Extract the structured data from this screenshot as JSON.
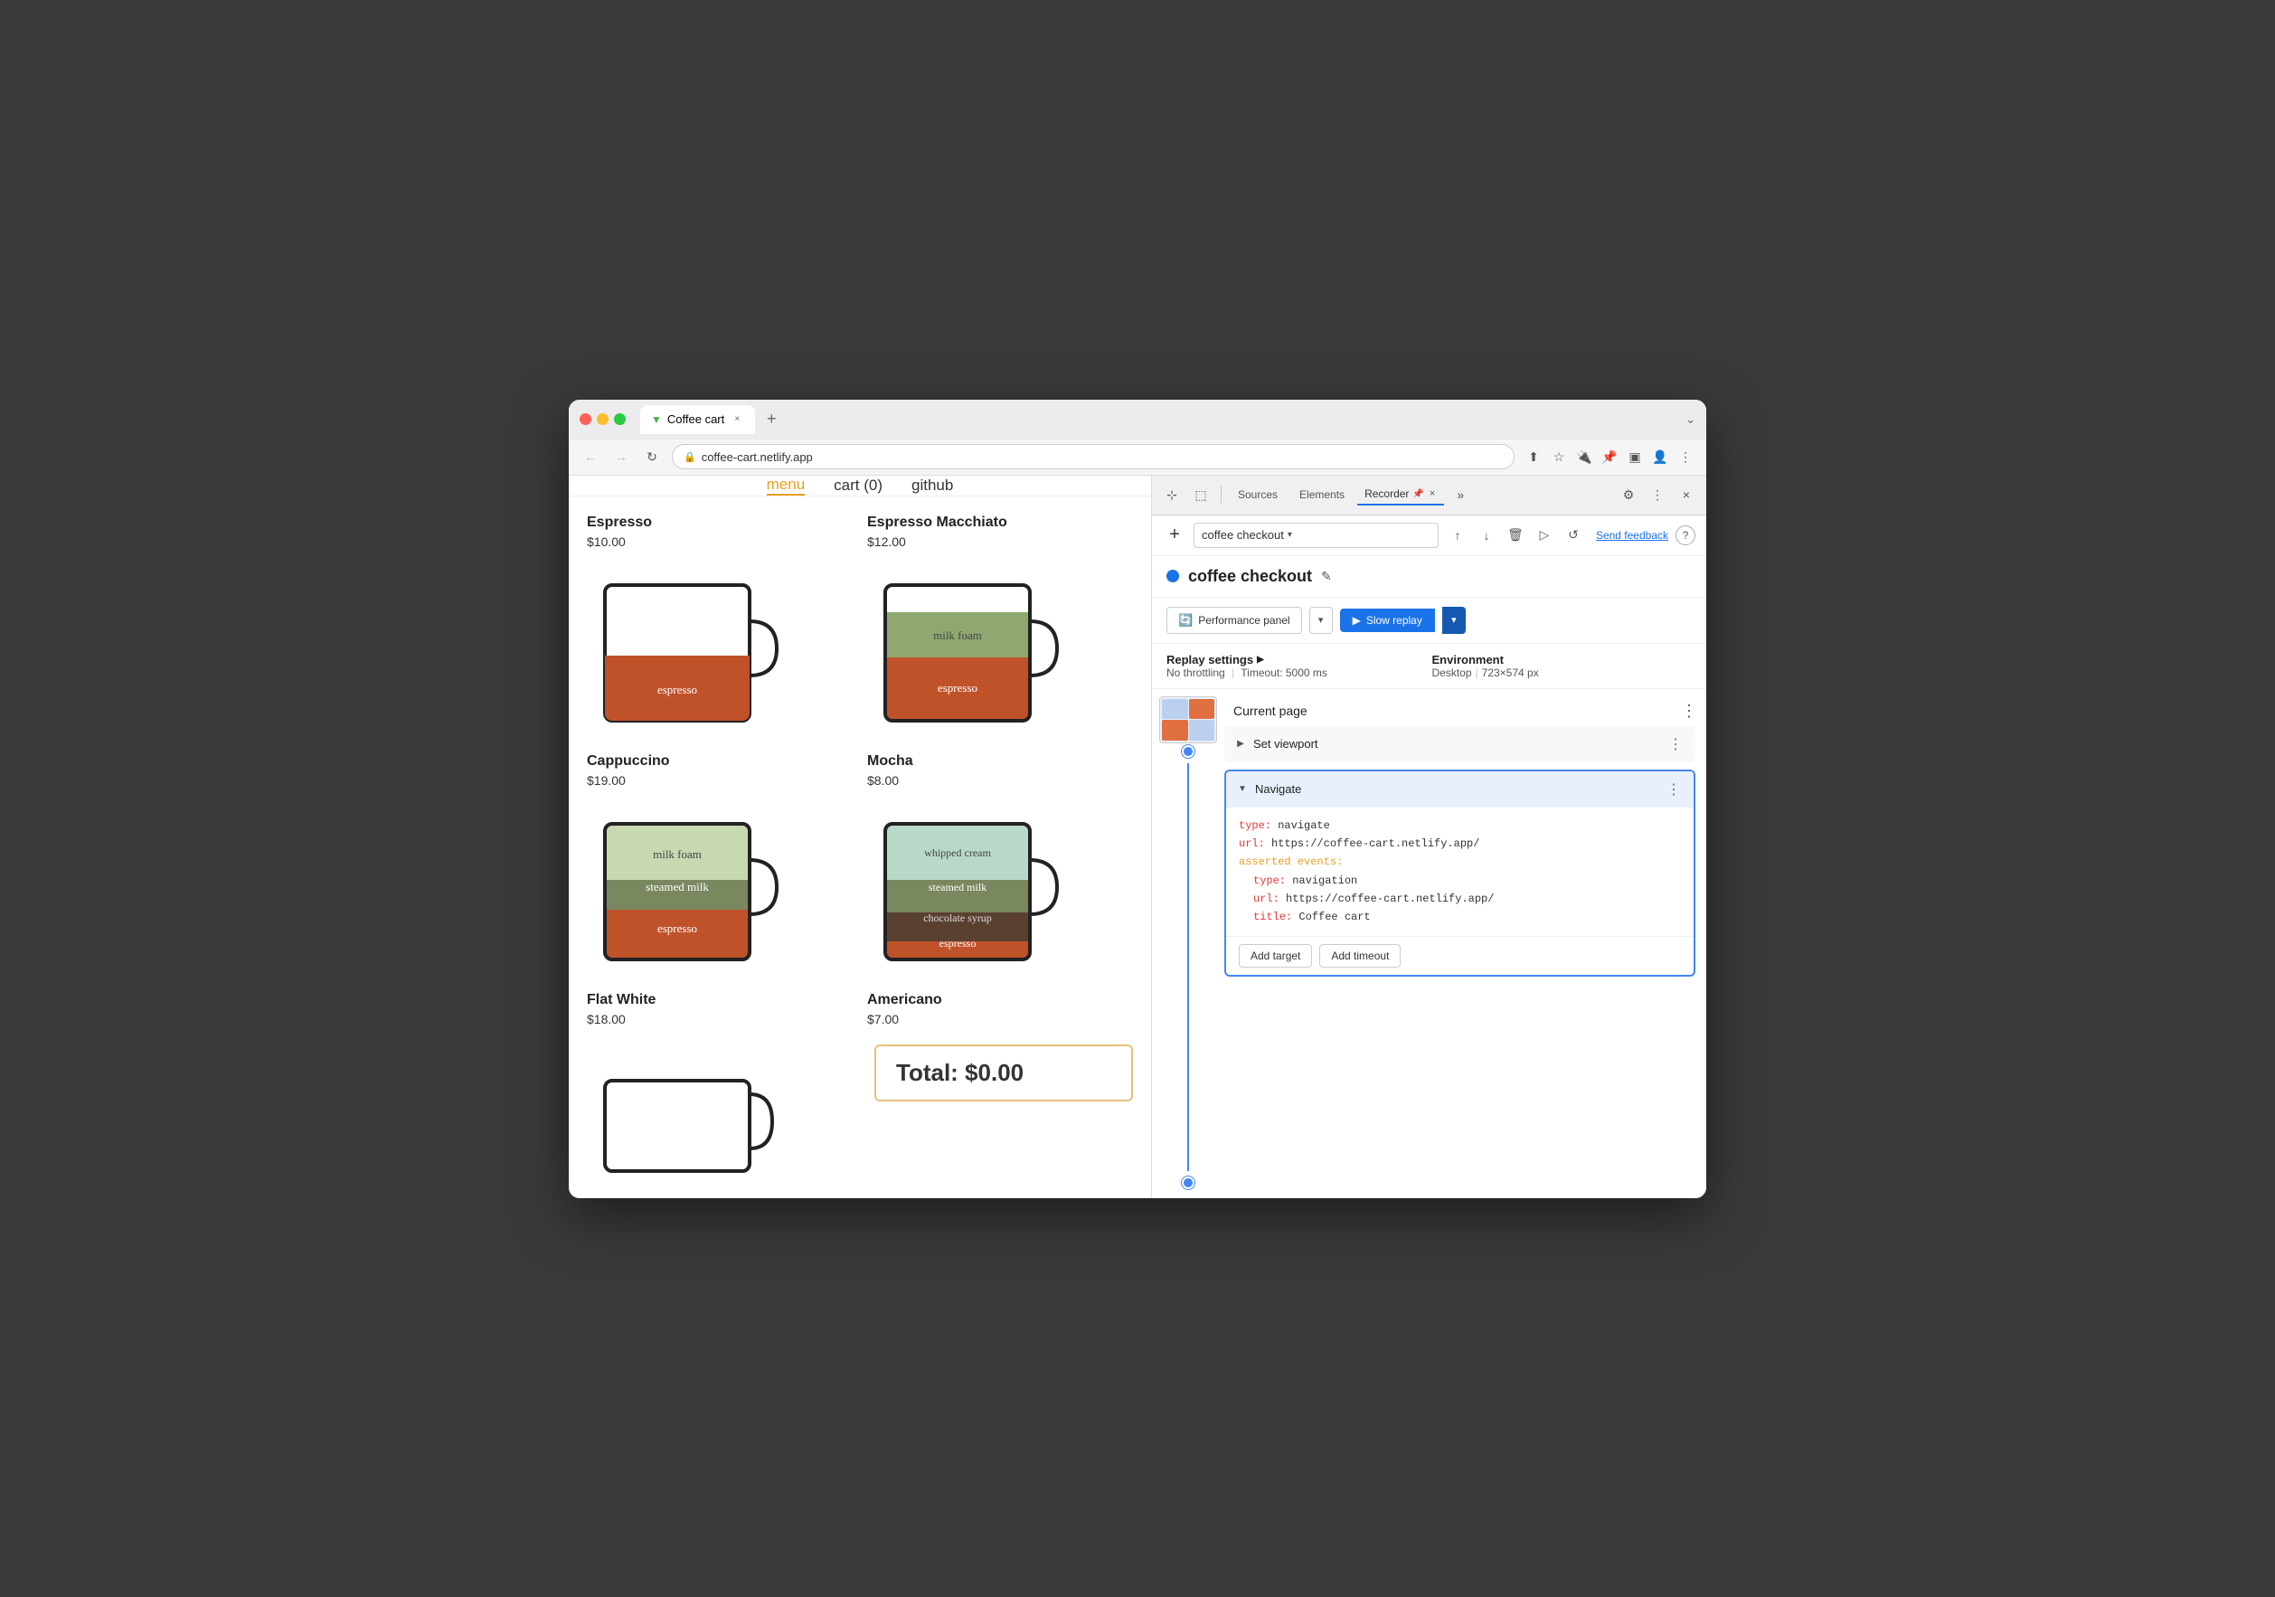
{
  "browser": {
    "tab_title": "Coffee cart",
    "tab_favicon": "▶",
    "url": "coffee-cart.netlify.app",
    "new_tab_label": "+",
    "window_expand": "⌄"
  },
  "nav": {
    "back": "←",
    "forward": "→",
    "refresh": "↻",
    "menu_link": "menu",
    "cart_link": "cart (0)",
    "github_link": "github"
  },
  "coffee_items": [
    {
      "name": "Espresso",
      "price": "$10.00",
      "layers": [
        {
          "label": "espresso",
          "color": "#c0522a",
          "height": 60
        }
      ]
    },
    {
      "name": "Espresso Macchiato",
      "price": "$12.00",
      "layers": [
        {
          "label": "milk foam",
          "color": "#8fa870",
          "height": 30
        },
        {
          "label": "espresso",
          "color": "#c0522a",
          "height": 60
        }
      ]
    },
    {
      "name": "Cappuccino",
      "price": "$19.00",
      "layers": [
        {
          "label": "milk foam",
          "color": "#c8d8b0",
          "height": 50
        },
        {
          "label": "steamed milk",
          "color": "#7a8860",
          "height": 35
        },
        {
          "label": "espresso",
          "color": "#c0522a",
          "height": 50
        }
      ]
    },
    {
      "name": "Mocha",
      "price": "$8.00",
      "layers": [
        {
          "label": "whipped cream",
          "color": "#b8d8c8",
          "height": 35
        },
        {
          "label": "steamed milk",
          "color": "#7a8860",
          "height": 35
        },
        {
          "label": "chocolate syrup",
          "color": "#5a4030",
          "height": 30
        },
        {
          "label": "espresso",
          "color": "#c0522a",
          "height": 40
        }
      ]
    },
    {
      "name": "Flat White",
      "price": "$18.00",
      "layers": []
    },
    {
      "name": "Americano",
      "price": "$7.00",
      "layers": []
    }
  ],
  "total": "Total: $0.00",
  "devtools": {
    "tabs": [
      "Sources",
      "Elements"
    ],
    "recorder_tab": "Recorder",
    "recorder_pin": "📌",
    "more_tabs": "»",
    "settings_icon": "⚙",
    "more_icon": "⋮",
    "close_icon": "×"
  },
  "recorder": {
    "add_btn": "+",
    "dropdown_value": "coffee checkout",
    "dropdown_arrow": "▾",
    "export_icon": "↑",
    "download_icon": "↓",
    "delete_icon": "🗑",
    "replay_icon": "▷",
    "more_icon": "↺",
    "send_feedback": "Send feedback",
    "help": "?",
    "recording_name": "coffee checkout",
    "edit_icon": "✎",
    "status_dot_color": "#1a73e8",
    "perf_panel_label": "Performance panel",
    "slow_replay_label": "Slow replay",
    "dropdown_arrow2": "▾",
    "replay_settings_label": "Replay settings",
    "replay_settings_arrow": "▶",
    "throttling_label": "No throttling",
    "timeout_label": "Timeout: 5000 ms",
    "environment_label": "Environment",
    "desktop_label": "Desktop",
    "resolution_label": "723×574 px",
    "current_page_label": "Current page",
    "current_page_menu": "⋮",
    "steps": [
      {
        "id": "set-viewport",
        "name": "Set viewport",
        "expanded": false,
        "selected": false,
        "menu": "⋮"
      },
      {
        "id": "navigate",
        "name": "Navigate",
        "expanded": true,
        "selected": true,
        "menu": "⋮",
        "code": {
          "type_key": "type:",
          "type_val": " navigate",
          "url_key": "url:",
          "url_val": " https://coffee-cart.netlify.app/",
          "asserted_key": "asserted events:",
          "asserted_type_key": "type:",
          "asserted_type_val": " navigation",
          "asserted_url_key": "url:",
          "asserted_url_val": " https://coffee-cart.netlify.app/",
          "asserted_title_key": "title:",
          "asserted_title_val": " Coffee cart"
        },
        "buttons": [
          "Add target",
          "Add timeout"
        ]
      }
    ]
  }
}
